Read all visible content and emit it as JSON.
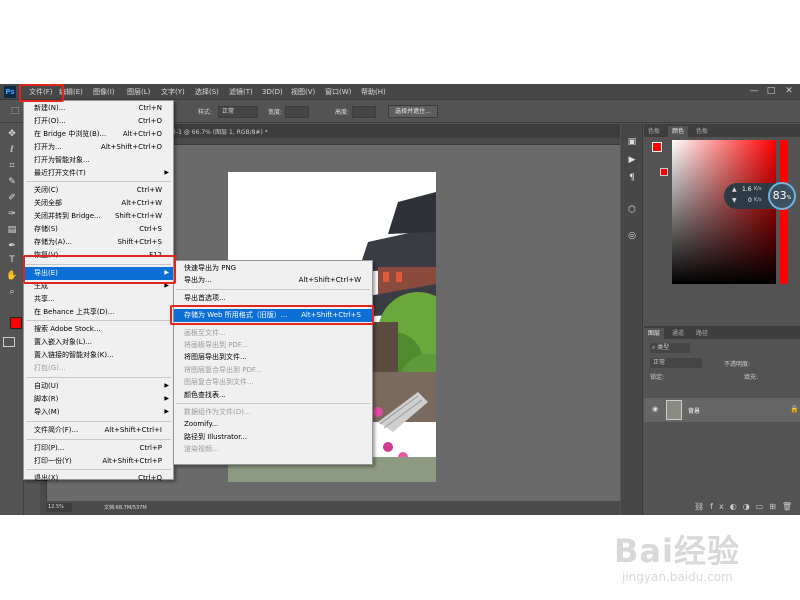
{
  "app": {
    "logo": "Ps",
    "menubar": [
      "文件(F)",
      "编辑(E)",
      "图像(I)",
      "图层(L)",
      "文字(Y)",
      "选择(S)",
      "滤镜(T)",
      "3D(D)",
      "视图(V)",
      "窗口(W)",
      "帮助(H)"
    ],
    "window_controls": [
      "—",
      "□",
      "✕"
    ]
  },
  "optbar": {
    "style_label": "样式:",
    "style_value": "正常",
    "width_label": "宽度:",
    "height_label": "高度:",
    "select_mask_button": "选择并遮住..."
  },
  "document": {
    "tab_title": "景-1 @ 66.7% (图层 1, RGB/8#) *",
    "zoom": "12.5%",
    "doc_info": "文档:68.7M/537M"
  },
  "file_menu": {
    "items": [
      {
        "label": "新建(N)...",
        "shortcut": "Ctrl+N",
        "disabled": false
      },
      {
        "label": "打开(O)...",
        "shortcut": "Ctrl+O",
        "disabled": false
      },
      {
        "label": "在 Bridge 中浏览(B)...",
        "shortcut": "Alt+Ctrl+O",
        "disabled": false
      },
      {
        "label": "打开为...",
        "shortcut": "Alt+Shift+Ctrl+O",
        "disabled": false
      },
      {
        "label": "打开为智能对象...",
        "shortcut": "",
        "disabled": false
      },
      {
        "label": "最近打开文件(T)",
        "shortcut": "",
        "disabled": false,
        "submenu": true
      },
      {
        "sep": true
      },
      {
        "label": "关闭(C)",
        "shortcut": "Ctrl+W",
        "disabled": false
      },
      {
        "label": "关闭全部",
        "shortcut": "Alt+Ctrl+W",
        "disabled": false
      },
      {
        "label": "关闭并转到 Bridge...",
        "shortcut": "Shift+Ctrl+W",
        "disabled": false
      },
      {
        "label": "存储(S)",
        "shortcut": "Ctrl+S",
        "disabled": false
      },
      {
        "label": "存储为(A)...",
        "shortcut": "Shift+Ctrl+S",
        "disabled": false
      },
      {
        "label": "恢复(V)",
        "shortcut": "F12",
        "disabled": false
      },
      {
        "sep": true
      },
      {
        "label": "导出(E)",
        "shortcut": "",
        "disabled": false,
        "submenu": true,
        "highlighted": true
      },
      {
        "label": "生成",
        "shortcut": "",
        "disabled": false,
        "submenu": true
      },
      {
        "label": "共享...",
        "shortcut": "",
        "disabled": false
      },
      {
        "label": "在 Behance 上共享(D)...",
        "shortcut": "",
        "disabled": false
      },
      {
        "sep": true
      },
      {
        "label": "搜索 Adobe Stock...",
        "shortcut": "",
        "disabled": false
      },
      {
        "label": "置入嵌入对象(L)...",
        "shortcut": "",
        "disabled": false
      },
      {
        "label": "置入链接的智能对象(K)...",
        "shortcut": "",
        "disabled": false
      },
      {
        "label": "打包(G)...",
        "shortcut": "",
        "disabled": true
      },
      {
        "sep": true
      },
      {
        "label": "自动(U)",
        "shortcut": "",
        "disabled": false,
        "submenu": true
      },
      {
        "label": "脚本(R)",
        "shortcut": "",
        "disabled": false,
        "submenu": true
      },
      {
        "label": "导入(M)",
        "shortcut": "",
        "disabled": false,
        "submenu": true
      },
      {
        "sep": true
      },
      {
        "label": "文件简介(F)...",
        "shortcut": "Alt+Shift+Ctrl+I",
        "disabled": false
      },
      {
        "sep": true
      },
      {
        "label": "打印(P)...",
        "shortcut": "Ctrl+P",
        "disabled": false
      },
      {
        "label": "打印一份(Y)",
        "shortcut": "Alt+Shift+Ctrl+P",
        "disabled": false
      },
      {
        "sep": true
      },
      {
        "label": "退出(X)",
        "shortcut": "Ctrl+Q",
        "disabled": false
      }
    ]
  },
  "export_menu": {
    "items": [
      {
        "label": "快速导出为 PNG",
        "shortcut": "",
        "disabled": false
      },
      {
        "label": "导出为...",
        "shortcut": "Alt+Shift+Ctrl+W",
        "disabled": false
      },
      {
        "sep": true
      },
      {
        "label": "导出首选项...",
        "shortcut": "",
        "disabled": false
      },
      {
        "sep": true
      },
      {
        "label": "存储为 Web 所用格式（旧版）...",
        "shortcut": "Alt+Shift+Ctrl+S",
        "disabled": false,
        "highlighted": true
      },
      {
        "sep": true
      },
      {
        "label": "画板至文件...",
        "shortcut": "",
        "disabled": true
      },
      {
        "label": "将画板导出到 PDF...",
        "shortcut": "",
        "disabled": true
      },
      {
        "label": "将图层导出到文件...",
        "shortcut": "",
        "disabled": false
      },
      {
        "label": "将图层复合导出到 PDF...",
        "shortcut": "",
        "disabled": true
      },
      {
        "label": "图层复合导出到文件...",
        "shortcut": "",
        "disabled": true
      },
      {
        "label": "颜色查找表...",
        "shortcut": "",
        "disabled": false
      },
      {
        "sep": true
      },
      {
        "label": "数据组作为文件(D)...",
        "shortcut": "",
        "disabled": true
      },
      {
        "label": "Zoomify...",
        "shortcut": "",
        "disabled": false
      },
      {
        "label": "路径到 Illustrator...",
        "shortcut": "",
        "disabled": false
      },
      {
        "label": "渲染视频...",
        "shortcut": "",
        "disabled": true
      }
    ]
  },
  "color_panel": {
    "tabs": [
      "色板",
      "颜色",
      "色板"
    ],
    "active_tab": 1,
    "foreground_color": "#ff0000",
    "background_color": "#ffffff"
  },
  "net_widget": {
    "up": "1.6",
    "up_unit": "K/s",
    "down": "0",
    "down_unit": "K/s",
    "percent": "83",
    "percent_unit": "%"
  },
  "layers_panel": {
    "tabs": [
      "图层",
      "通道",
      "路径"
    ],
    "active_tab": 0,
    "filter_label": "类型",
    "blend_mode": "正常",
    "opacity_label": "不透明度:",
    "lock_label": "锁定:",
    "fill_label": "填充:",
    "layers": [
      {
        "name": "背景",
        "locked": true
      }
    ]
  },
  "watermark": {
    "brand": "Bai经验",
    "url": "jingyan.baidu.com"
  }
}
